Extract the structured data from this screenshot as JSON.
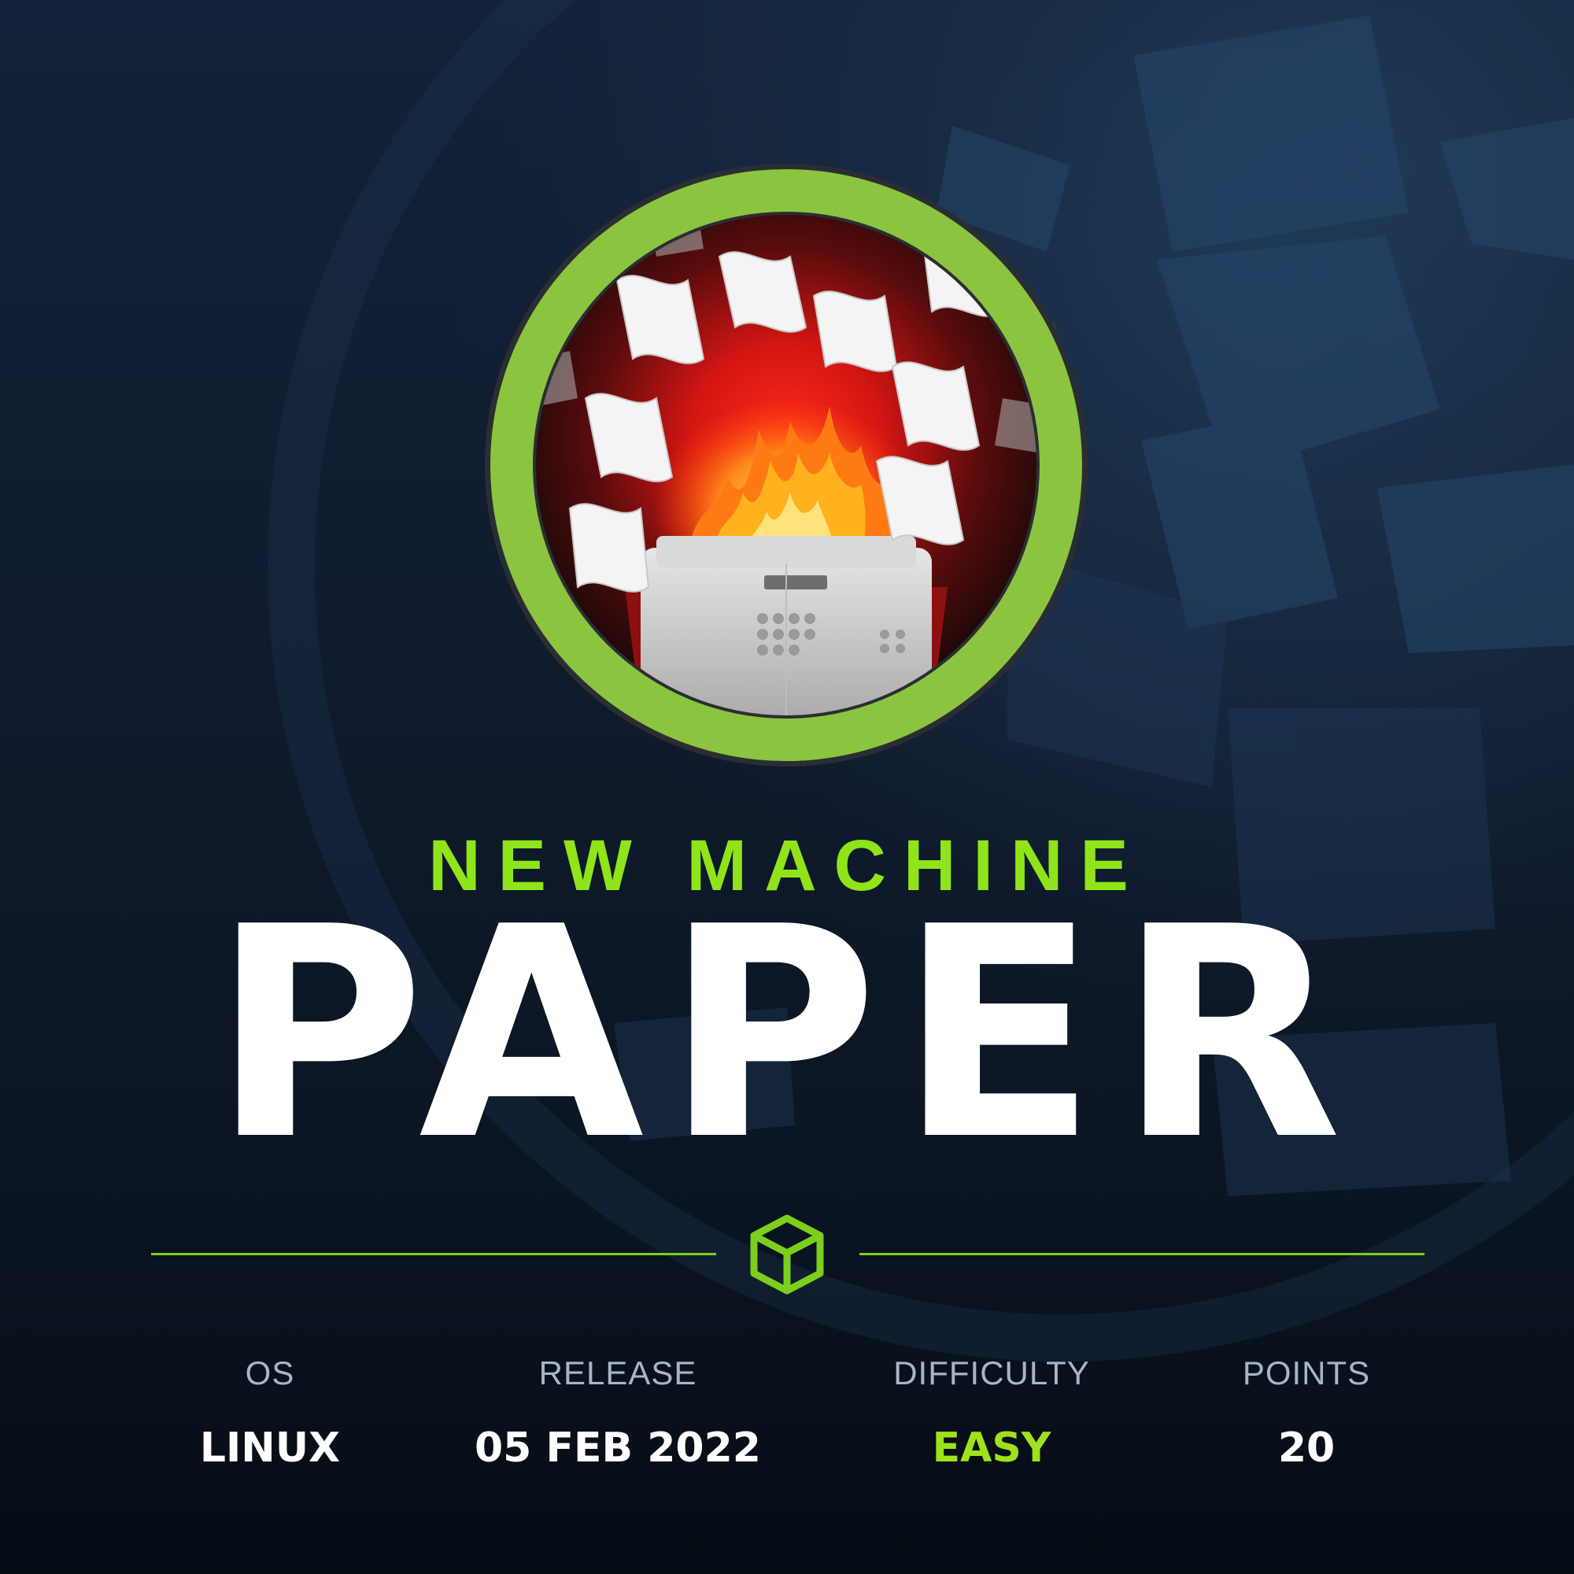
{
  "header": {
    "eyebrow": "NEW MACHINE",
    "title": "PAPER"
  },
  "badge": {
    "icon": "burning-fax-machine-icon",
    "ring_color": "#8bc53f"
  },
  "divider": {
    "icon": "cube-icon",
    "color": "#7ccf1c"
  },
  "stats": [
    {
      "label": "OS",
      "value": "LINUX"
    },
    {
      "label": "RELEASE",
      "value": "05 FEB 2022"
    },
    {
      "label": "DIFFICULTY",
      "value": "EASY"
    },
    {
      "label": "POINTS",
      "value": "20"
    }
  ],
  "colors": {
    "accent": "#8fe41a",
    "background": "#0d1624",
    "text": "#ffffff",
    "label": "#a9b3c9"
  }
}
